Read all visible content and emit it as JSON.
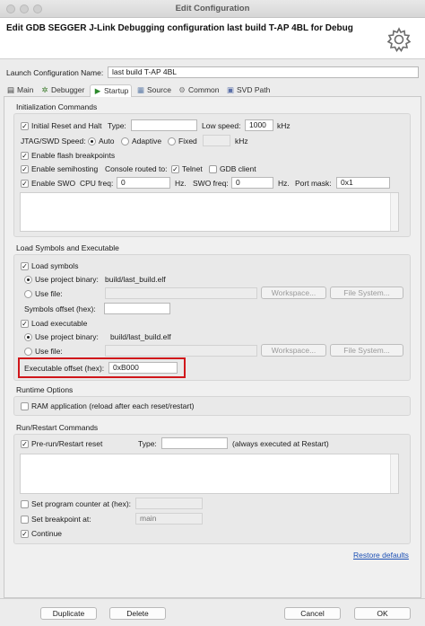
{
  "window": {
    "title": "Edit Configuration"
  },
  "header": {
    "title": "Edit GDB SEGGER J-Link Debugging configuration last build T-AP 4BL for Debug",
    "icon": "gear-icon"
  },
  "launch": {
    "label": "Launch Configuration Name:",
    "value": "last build T-AP 4BL"
  },
  "tabs": [
    {
      "label": "Main",
      "icon": "main-icon"
    },
    {
      "label": "Debugger",
      "icon": "debugger-icon"
    },
    {
      "label": "Startup",
      "icon": "startup-icon",
      "active": true
    },
    {
      "label": "Source",
      "icon": "source-icon"
    },
    {
      "label": "Common",
      "icon": "common-icon"
    },
    {
      "label": "SVD Path",
      "icon": "svd-icon"
    }
  ],
  "init": {
    "title": "Initialization Commands",
    "reset_label": "Initial Reset and Halt",
    "type_label": "Type:",
    "type_value": "",
    "low_speed_label": "Low speed:",
    "low_speed_value": "1000",
    "khz": "kHz",
    "jtag_label": "JTAG/SWD Speed:",
    "auto": "Auto",
    "adaptive": "Adaptive",
    "fixed": "Fixed",
    "fixed_value": "",
    "khz2": "kHz",
    "flash_bp": "Enable flash breakpoints",
    "semihosting": "Enable semihosting",
    "console_routed": "Console routed to:",
    "telnet": "Telnet",
    "gdb_client": "GDB client",
    "swo": "Enable SWO",
    "cpu_freq_label": "CPU freq:",
    "cpu_freq_value": "0",
    "hz1": "Hz.",
    "swo_freq_label": "SWO freq:",
    "swo_freq_value": "0",
    "hz2": "Hz.",
    "port_mask_label": "Port mask:",
    "port_mask_value": "0x1"
  },
  "load": {
    "title": "Load Symbols and Executable",
    "load_symbols": "Load symbols",
    "use_project_binary": "Use project binary:",
    "symbols_binary": "build/last_build.elf",
    "use_file": "Use file:",
    "workspace": "Workspace...",
    "file_system": "File System...",
    "symbols_offset_label": "Symbols offset (hex):",
    "symbols_offset_value": "",
    "load_executable": "Load executable",
    "use_project_binary2": "Use project binary:",
    "exec_binary": "build/last_build.elf",
    "use_file2": "Use file:",
    "workspace2": "Workspace...",
    "file_system2": "File System...",
    "exec_offset_label": "Executable offset (hex):",
    "exec_offset_value": "0xB000"
  },
  "runtime": {
    "title": "Runtime Options",
    "ram_app": "RAM application (reload after each reset/restart)"
  },
  "run": {
    "title": "Run/Restart Commands",
    "pre_run": "Pre-run/Restart reset",
    "type_label": "Type:",
    "type_value": "",
    "always": "(always executed at Restart)",
    "set_pc": "Set program counter at (hex):",
    "set_pc_value": "",
    "set_bp": "Set breakpoint at:",
    "set_bp_value": "main",
    "continue": "Continue"
  },
  "restore_defaults": "Restore defaults",
  "footer": {
    "duplicate": "Duplicate",
    "delete": "Delete",
    "cancel": "Cancel",
    "ok": "OK"
  }
}
